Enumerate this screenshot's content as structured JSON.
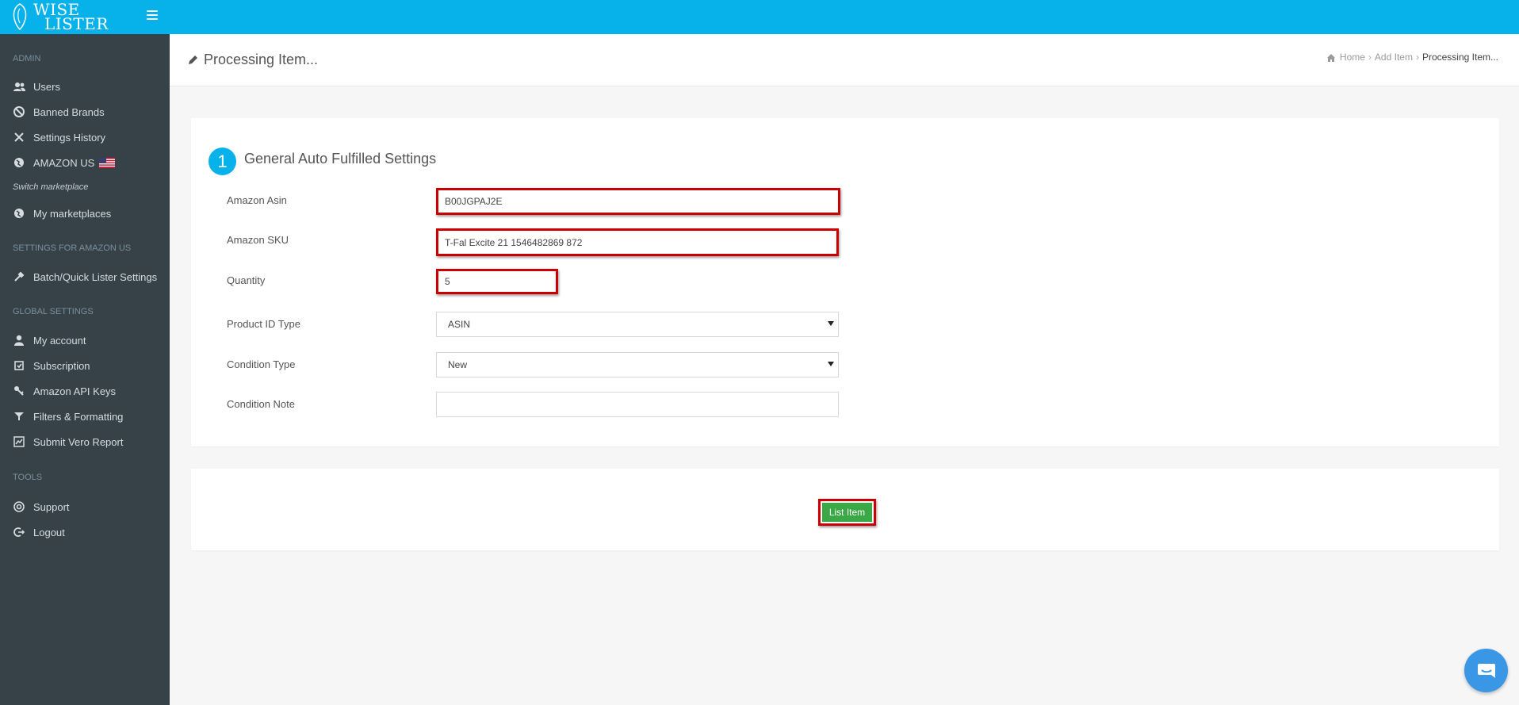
{
  "brand": {
    "line1": "WISE",
    "line2": "LISTER"
  },
  "sidebar": {
    "sections": {
      "admin": "ADMIN",
      "settings_for": "SETTINGS FOR AMAZON US",
      "global": "GLOBAL SETTINGS",
      "tools": "TOOLS"
    },
    "items": [
      {
        "label": "Users",
        "icon": "users-icon"
      },
      {
        "label": "Banned Brands",
        "icon": "banned-icon"
      },
      {
        "label": "Settings History",
        "icon": "tools-icon"
      },
      {
        "label": "AMAZON US",
        "icon": "globe-icon"
      },
      {
        "label": "My marketplaces",
        "icon": "globe-icon"
      },
      {
        "label": "Batch/Quick Lister Settings",
        "icon": "wrench-icon"
      },
      {
        "label": "My account",
        "icon": "user-icon"
      },
      {
        "label": "Subscription",
        "icon": "subscription-icon"
      },
      {
        "label": "Amazon API Keys",
        "icon": "key-icon"
      },
      {
        "label": "Filters & Formatting",
        "icon": "filter-icon"
      },
      {
        "label": "Submit Vero Report",
        "icon": "report-icon"
      },
      {
        "label": "Support",
        "icon": "support-icon"
      },
      {
        "label": "Logout",
        "icon": "logout-icon"
      }
    ],
    "switch_note": "Switch marketplace"
  },
  "header": {
    "title": "Processing Item...",
    "breadcrumb": [
      "Home",
      "Add Item",
      "Processing Item..."
    ]
  },
  "form": {
    "step_number": "1",
    "step_title": "General Auto Fulfilled Settings",
    "fields": {
      "asin": {
        "label": "Amazon Asin",
        "value": "B00JGPAJ2E"
      },
      "sku": {
        "label": "Amazon SKU",
        "value": "T-Fal Excite 21 1546482869 872"
      },
      "quantity": {
        "label": "Quantity",
        "value": "5"
      },
      "product_id_type": {
        "label": "Product ID Type",
        "value": "ASIN"
      },
      "condition_type": {
        "label": "Condition Type",
        "value": "New"
      },
      "condition_note": {
        "label": "Condition Note",
        "value": ""
      }
    }
  },
  "actions": {
    "list_item": "List Item"
  },
  "colors": {
    "topbar": "#07b1ea",
    "sidebar": "#364148",
    "accent": "#07b1ea",
    "button": "#3aa845",
    "highlight": "#cc0000"
  }
}
